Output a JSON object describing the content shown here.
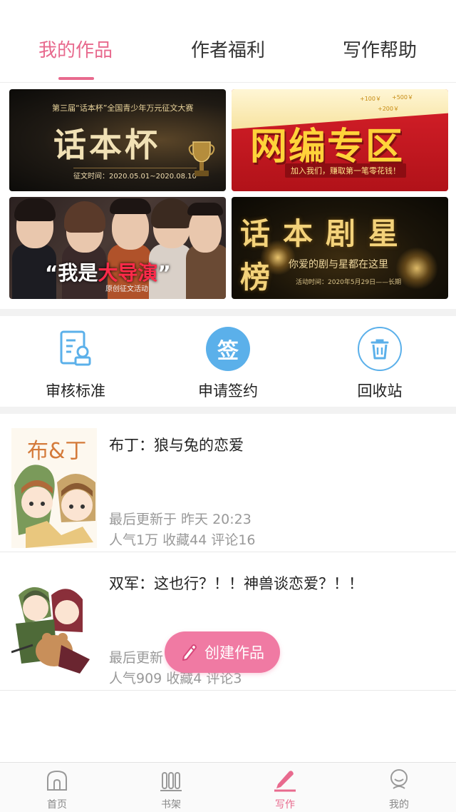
{
  "top_tabs": [
    {
      "label": "我的作品",
      "active": true
    },
    {
      "label": "作者福利",
      "active": false
    },
    {
      "label": "写作帮助",
      "active": false
    }
  ],
  "banners": {
    "b1": {
      "small": "第三届“话本杯”全国青少年万元征文大赛",
      "big": "话本杯",
      "date": "征文时间：2020.05.01~2020.08.10"
    },
    "b2": {
      "big": "网编专区",
      "tag": "加入我们，赚取第一笔零花钱！",
      "coins": [
        "+100￥",
        "+500￥",
        "+200￥"
      ]
    },
    "b3": {
      "prefix": "“我是",
      "highlight": "大导演",
      "suffix": "”",
      "sub": "原创征文活动"
    },
    "b4": {
      "big": "话本剧星榜",
      "sub": "你爱的剧与星都在这里",
      "date": "活动时间：2020年5月29日——长期"
    }
  },
  "quick_actions": [
    {
      "label": "审核标准",
      "icon": "document-check-icon"
    },
    {
      "label": "申请签约",
      "icon": "sign-badge-icon",
      "icon_text": "签"
    },
    {
      "label": "回收站",
      "icon": "trash-icon"
    }
  ],
  "works": [
    {
      "title": "布丁：狼与兔的恋爱",
      "updated": "最后更新于 昨天 20:23",
      "stats": "人气1万 收藏44 评论16",
      "cover_text": "布&丁"
    },
    {
      "title": "双军：这也行？！！神兽谈恋爱？！！",
      "updated": "最后更新",
      "stats": "人气909 收藏4 评论3"
    }
  ],
  "fab": {
    "label": "创建作品",
    "icon": "pencil-icon"
  },
  "bottom_nav": [
    {
      "label": "首页",
      "icon": "home-icon",
      "active": false
    },
    {
      "label": "书架",
      "icon": "bookshelf-icon",
      "active": false
    },
    {
      "label": "写作",
      "icon": "pen-icon",
      "active": true
    },
    {
      "label": "我的",
      "icon": "profile-icon",
      "active": false
    }
  ],
  "colors": {
    "accent": "#e86a8e",
    "fab": "#f07aa3",
    "icon_blue": "#5bb0ea"
  }
}
